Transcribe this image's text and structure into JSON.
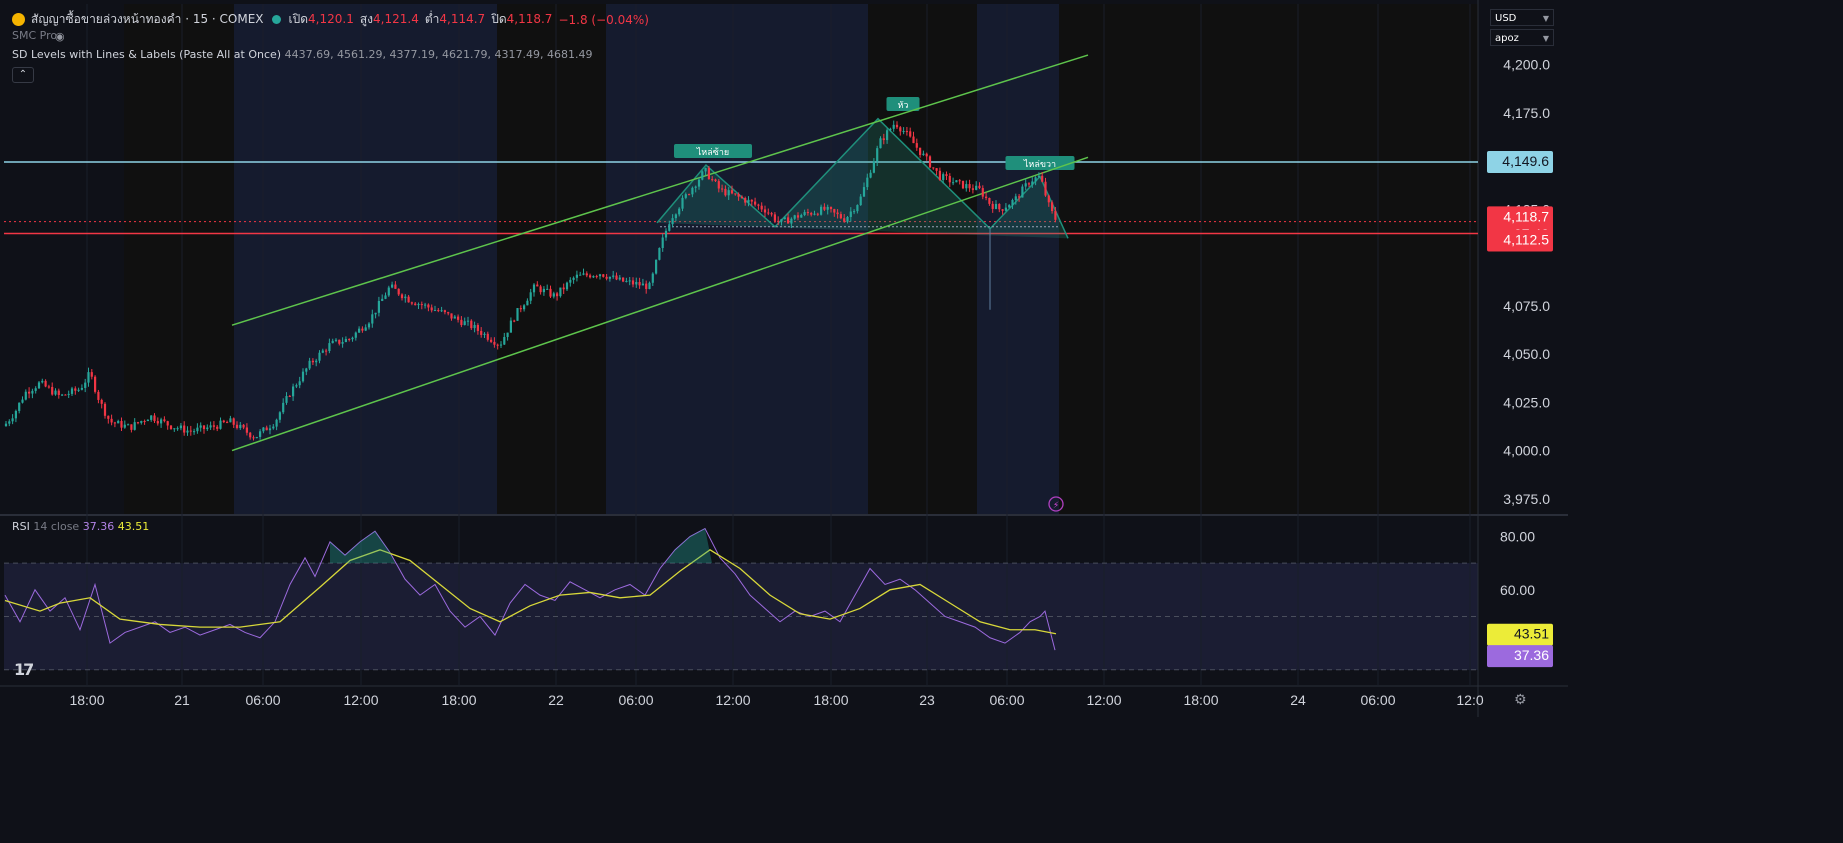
{
  "header": {
    "symbol_title": "สัญญาซื้อขายล่วงหน้าทองคำ · 15 · COMEX",
    "open_label": "เปิด",
    "open_value": "4,120.1",
    "high_label": "สูง",
    "high_value": "4,121.4",
    "low_label": "ต่ำ",
    "low_value": "4,114.7",
    "close_label": "ปิด",
    "close_value": "4,118.7",
    "change": "−1.8 (−0.04%)"
  },
  "indicators": {
    "smc": "SMC Pro",
    "sd_name": "SD Levels with Lines & Labels (Paste All at Once)",
    "sd_values": "4437.69, 4561.29, 4377.19, 4621.79, 4317.49, 4681.49"
  },
  "controls": {
    "currency": "USD",
    "account": "apoz"
  },
  "rsi_label": {
    "name": "RSI",
    "params": "14 close",
    "rsi": "37.36",
    "ma": "43.51"
  },
  "colors": {
    "up": "#26a69a",
    "down": "#f23645",
    "channel": "#5ec44c",
    "neckline": "#8ed3e6",
    "current_line": "#f23645",
    "rsi": "#9c6ade",
    "rsi_ma": "#d8d83a",
    "pattern": "#1f8f7b"
  },
  "chart_data": [
    {
      "type": "candlestick",
      "title": "สัญญาซื้อขายล่วงหน้าทองคำ · 15 · COMEX",
      "ylim": [
        3965,
        4225
      ],
      "y_ticks": [
        "4,200.0",
        "4,175.0",
        "4,125.0",
        "4,075.0",
        "4,050.0",
        "4,025.0",
        "4,000.0",
        "3,975.0"
      ],
      "x_ticks": [
        "18:00",
        "21",
        "06:00",
        "12:00",
        "18:00",
        "22",
        "06:00",
        "12:00",
        "18:00",
        "23",
        "06:00",
        "12:00",
        "18:00",
        "24",
        "06:00",
        "12:0"
      ],
      "price_trajectory": [
        [
          0,
          4010
        ],
        [
          15,
          4020
        ],
        [
          25,
          4030
        ],
        [
          40,
          4035
        ],
        [
          60,
          4028
        ],
        [
          80,
          4032
        ],
        [
          90,
          4040
        ],
        [
          100,
          4025
        ],
        [
          110,
          4015
        ],
        [
          130,
          4012
        ],
        [
          150,
          4018
        ],
        [
          170,
          4013
        ],
        [
          190,
          4010
        ],
        [
          210,
          4012
        ],
        [
          230,
          4015
        ],
        [
          255,
          4007
        ],
        [
          275,
          4015
        ],
        [
          290,
          4030
        ],
        [
          310,
          4045
        ],
        [
          330,
          4055
        ],
        [
          350,
          4058
        ],
        [
          370,
          4068
        ],
        [
          390,
          4085
        ],
        [
          410,
          4078
        ],
        [
          440,
          4072
        ],
        [
          470,
          4065
        ],
        [
          500,
          4055
        ],
        [
          515,
          4070
        ],
        [
          535,
          4085
        ],
        [
          555,
          4080
        ],
        [
          575,
          4090
        ],
        [
          600,
          4092
        ],
        [
          620,
          4088
        ],
        [
          650,
          4085
        ],
        [
          660,
          4105
        ],
        [
          670,
          4120
        ],
        [
          690,
          4135
        ],
        [
          705,
          4145
        ],
        [
          720,
          4135
        ],
        [
          745,
          4130
        ],
        [
          765,
          4125
        ],
        [
          780,
          4118
        ],
        [
          800,
          4122
        ],
        [
          825,
          4125
        ],
        [
          845,
          4120
        ],
        [
          860,
          4130
        ],
        [
          870,
          4145
        ],
        [
          880,
          4160
        ],
        [
          895,
          4170
        ],
        [
          905,
          4165
        ],
        [
          920,
          4155
        ],
        [
          940,
          4142
        ],
        [
          960,
          4138
        ],
        [
          980,
          4135
        ],
        [
          990,
          4128
        ],
        [
          1000,
          4125
        ],
        [
          1015,
          4130
        ],
        [
          1030,
          4140
        ],
        [
          1040,
          4142
        ],
        [
          1050,
          4125
        ],
        [
          1057,
          4118.7
        ]
      ],
      "price_labels": [
        {
          "value": "4,149.6",
          "kind": "neckline"
        },
        {
          "value": "4,118.7",
          "kind": "current",
          "countdown": "07:40"
        },
        {
          "value": "4,112.5",
          "kind": "level"
        }
      ],
      "pattern_labels": [
        "ไหล่ซ้าย",
        "หัว",
        "ไหล่ขวา"
      ],
      "channel": {
        "upper": [
          [
            232,
            4065
          ],
          [
            1088,
            4205
          ]
        ],
        "lower": [
          [
            232,
            4000
          ],
          [
            1088,
            4152
          ]
        ]
      },
      "horizontal_levels": [
        4149.6,
        4112.5
      ]
    },
    {
      "type": "line",
      "title": "RSI 14 close",
      "ylim": [
        38,
        84
      ],
      "y_ticks": [
        "80.00",
        "60.00"
      ],
      "bands": [
        70,
        50,
        30
      ],
      "series": [
        {
          "name": "RSI",
          "points": [
            [
              5,
              58
            ],
            [
              20,
              48
            ],
            [
              35,
              60
            ],
            [
              50,
              52
            ],
            [
              65,
              57
            ],
            [
              80,
              45
            ],
            [
              95,
              62
            ],
            [
              110,
              40
            ],
            [
              125,
              44
            ],
            [
              140,
              46
            ],
            [
              155,
              48
            ],
            [
              170,
              44
            ],
            [
              185,
              46
            ],
            [
              200,
              43
            ],
            [
              215,
              45
            ],
            [
              230,
              47
            ],
            [
              245,
              44
            ],
            [
              260,
              42
            ],
            [
              275,
              48
            ],
            [
              290,
              62
            ],
            [
              305,
              72
            ],
            [
              315,
              65
            ],
            [
              330,
              78
            ],
            [
              345,
              73
            ],
            [
              360,
              78
            ],
            [
              375,
              82
            ],
            [
              390,
              74
            ],
            [
              405,
              64
            ],
            [
              420,
              58
            ],
            [
              435,
              62
            ],
            [
              450,
              52
            ],
            [
              465,
              46
            ],
            [
              480,
              50
            ],
            [
              495,
              43
            ],
            [
              510,
              55
            ],
            [
              525,
              62
            ],
            [
              540,
              58
            ],
            [
              555,
              56
            ],
            [
              570,
              63
            ],
            [
              585,
              60
            ],
            [
              600,
              57
            ],
            [
              615,
              60
            ],
            [
              630,
              62
            ],
            [
              645,
              58
            ],
            [
              660,
              68
            ],
            [
              675,
              75
            ],
            [
              690,
              80
            ],
            [
              705,
              83
            ],
            [
              720,
              72
            ],
            [
              735,
              66
            ],
            [
              750,
              58
            ],
            [
              765,
              53
            ],
            [
              780,
              48
            ],
            [
              795,
              52
            ],
            [
              810,
              50
            ],
            [
              825,
              52
            ],
            [
              840,
              48
            ],
            [
              855,
              58
            ],
            [
              870,
              68
            ],
            [
              885,
              62
            ],
            [
              900,
              64
            ],
            [
              915,
              60
            ],
            [
              930,
              55
            ],
            [
              945,
              50
            ],
            [
              960,
              48
            ],
            [
              975,
              46
            ],
            [
              990,
              42
            ],
            [
              1005,
              40
            ],
            [
              1020,
              44
            ],
            [
              1030,
              48
            ],
            [
              1040,
              50
            ],
            [
              1045,
              52
            ],
            [
              1055,
              37.36
            ]
          ]
        },
        {
          "name": "MA",
          "points": [
            [
              5,
              56
            ],
            [
              40,
              52
            ],
            [
              60,
              55
            ],
            [
              90,
              57
            ],
            [
              120,
              49
            ],
            [
              160,
              47
            ],
            [
              200,
              46
            ],
            [
              240,
              46
            ],
            [
              280,
              48
            ],
            [
              320,
              61
            ],
            [
              350,
              71
            ],
            [
              380,
              75
            ],
            [
              410,
              71
            ],
            [
              440,
              62
            ],
            [
              470,
              53
            ],
            [
              500,
              48
            ],
            [
              530,
              54
            ],
            [
              560,
              58
            ],
            [
              590,
              59
            ],
            [
              620,
              57
            ],
            [
              650,
              58
            ],
            [
              680,
              67
            ],
            [
              710,
              75
            ],
            [
              740,
              68
            ],
            [
              770,
              58
            ],
            [
              800,
              51
            ],
            [
              830,
              49
            ],
            [
              860,
              53
            ],
            [
              890,
              60
            ],
            [
              920,
              62
            ],
            [
              950,
              55
            ],
            [
              980,
              48
            ],
            [
              1010,
              45
            ],
            [
              1035,
              45
            ],
            [
              1056,
              43.51
            ]
          ]
        }
      ],
      "price_labels": [
        {
          "value": "43.51",
          "kind": "ma"
        },
        {
          "value": "37.36",
          "kind": "rsi"
        }
      ]
    }
  ]
}
